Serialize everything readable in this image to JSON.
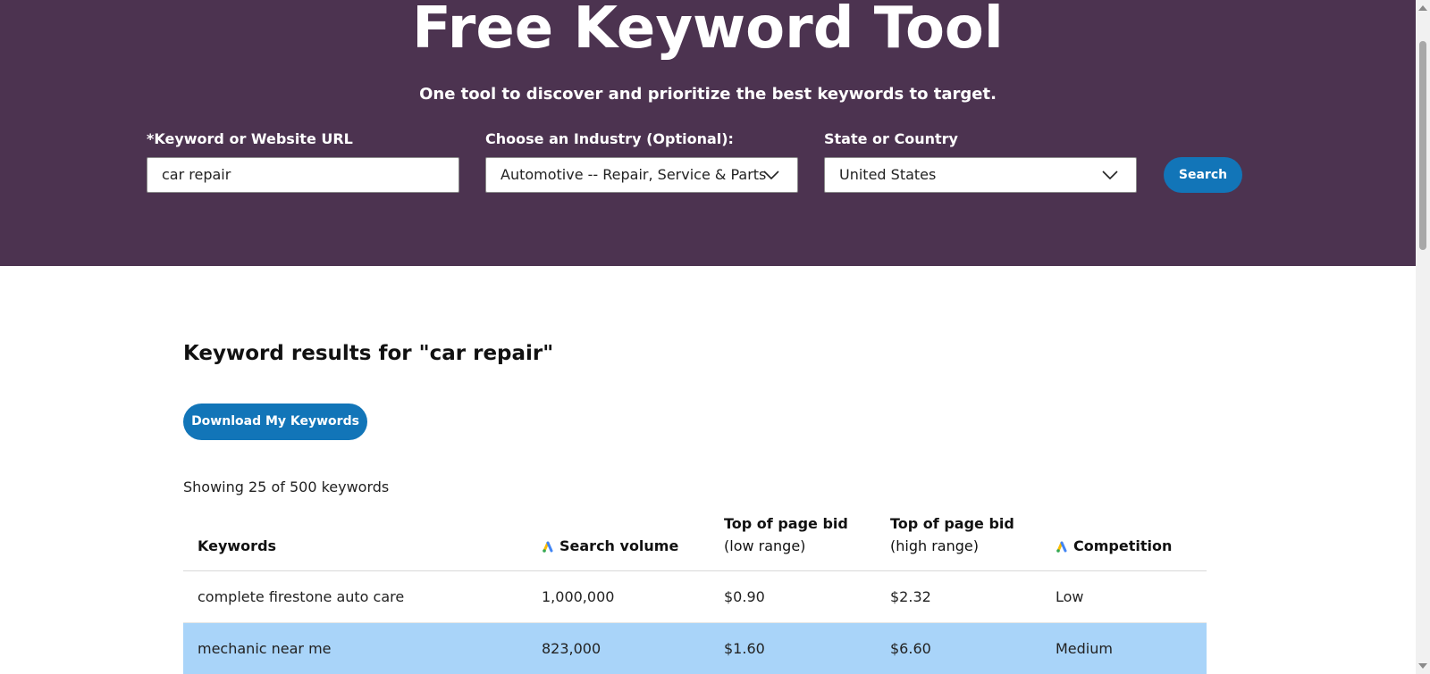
{
  "hero": {
    "title": "Free Keyword Tool",
    "subtitle": "One tool to discover and prioritize the best keywords to target.",
    "background_color": "#4c3350"
  },
  "form": {
    "keyword_label": "*Keyword or Website URL",
    "keyword_value": "car repair",
    "industry_label": "Choose an Industry (Optional):",
    "industry_value": "Automotive -- Repair, Service & Parts",
    "location_label": "State or Country",
    "location_value": "United States",
    "search_label": "Search",
    "button_color": "#1275b8"
  },
  "results": {
    "title": "Keyword results for \"car repair\"",
    "download_label": "Download My Keywords",
    "showing_text": "Showing 25 of 500 keywords",
    "columns": {
      "keywords": "Keywords",
      "search_volume": "Search volume",
      "bid_low_title": "Top of page bid",
      "bid_low_sub": "(low range)",
      "bid_high_title": "Top of page bid",
      "bid_high_sub": "(high range)",
      "competition": "Competition"
    },
    "rows": [
      {
        "keyword": "complete firestone auto care",
        "volume": "1,000,000",
        "bid_low": "$0.90",
        "bid_high": "$2.32",
        "competition": "Low",
        "highlighted": false
      },
      {
        "keyword": "mechanic near me",
        "volume": "823,000",
        "bid_low": "$1.60",
        "bid_high": "$6.60",
        "competition": "Medium",
        "highlighted": true
      }
    ],
    "highlight_color": "#a9d4f9"
  },
  "icons": {
    "dropdown": "chevron-down-icon",
    "column_source": "google-ads-icon"
  }
}
